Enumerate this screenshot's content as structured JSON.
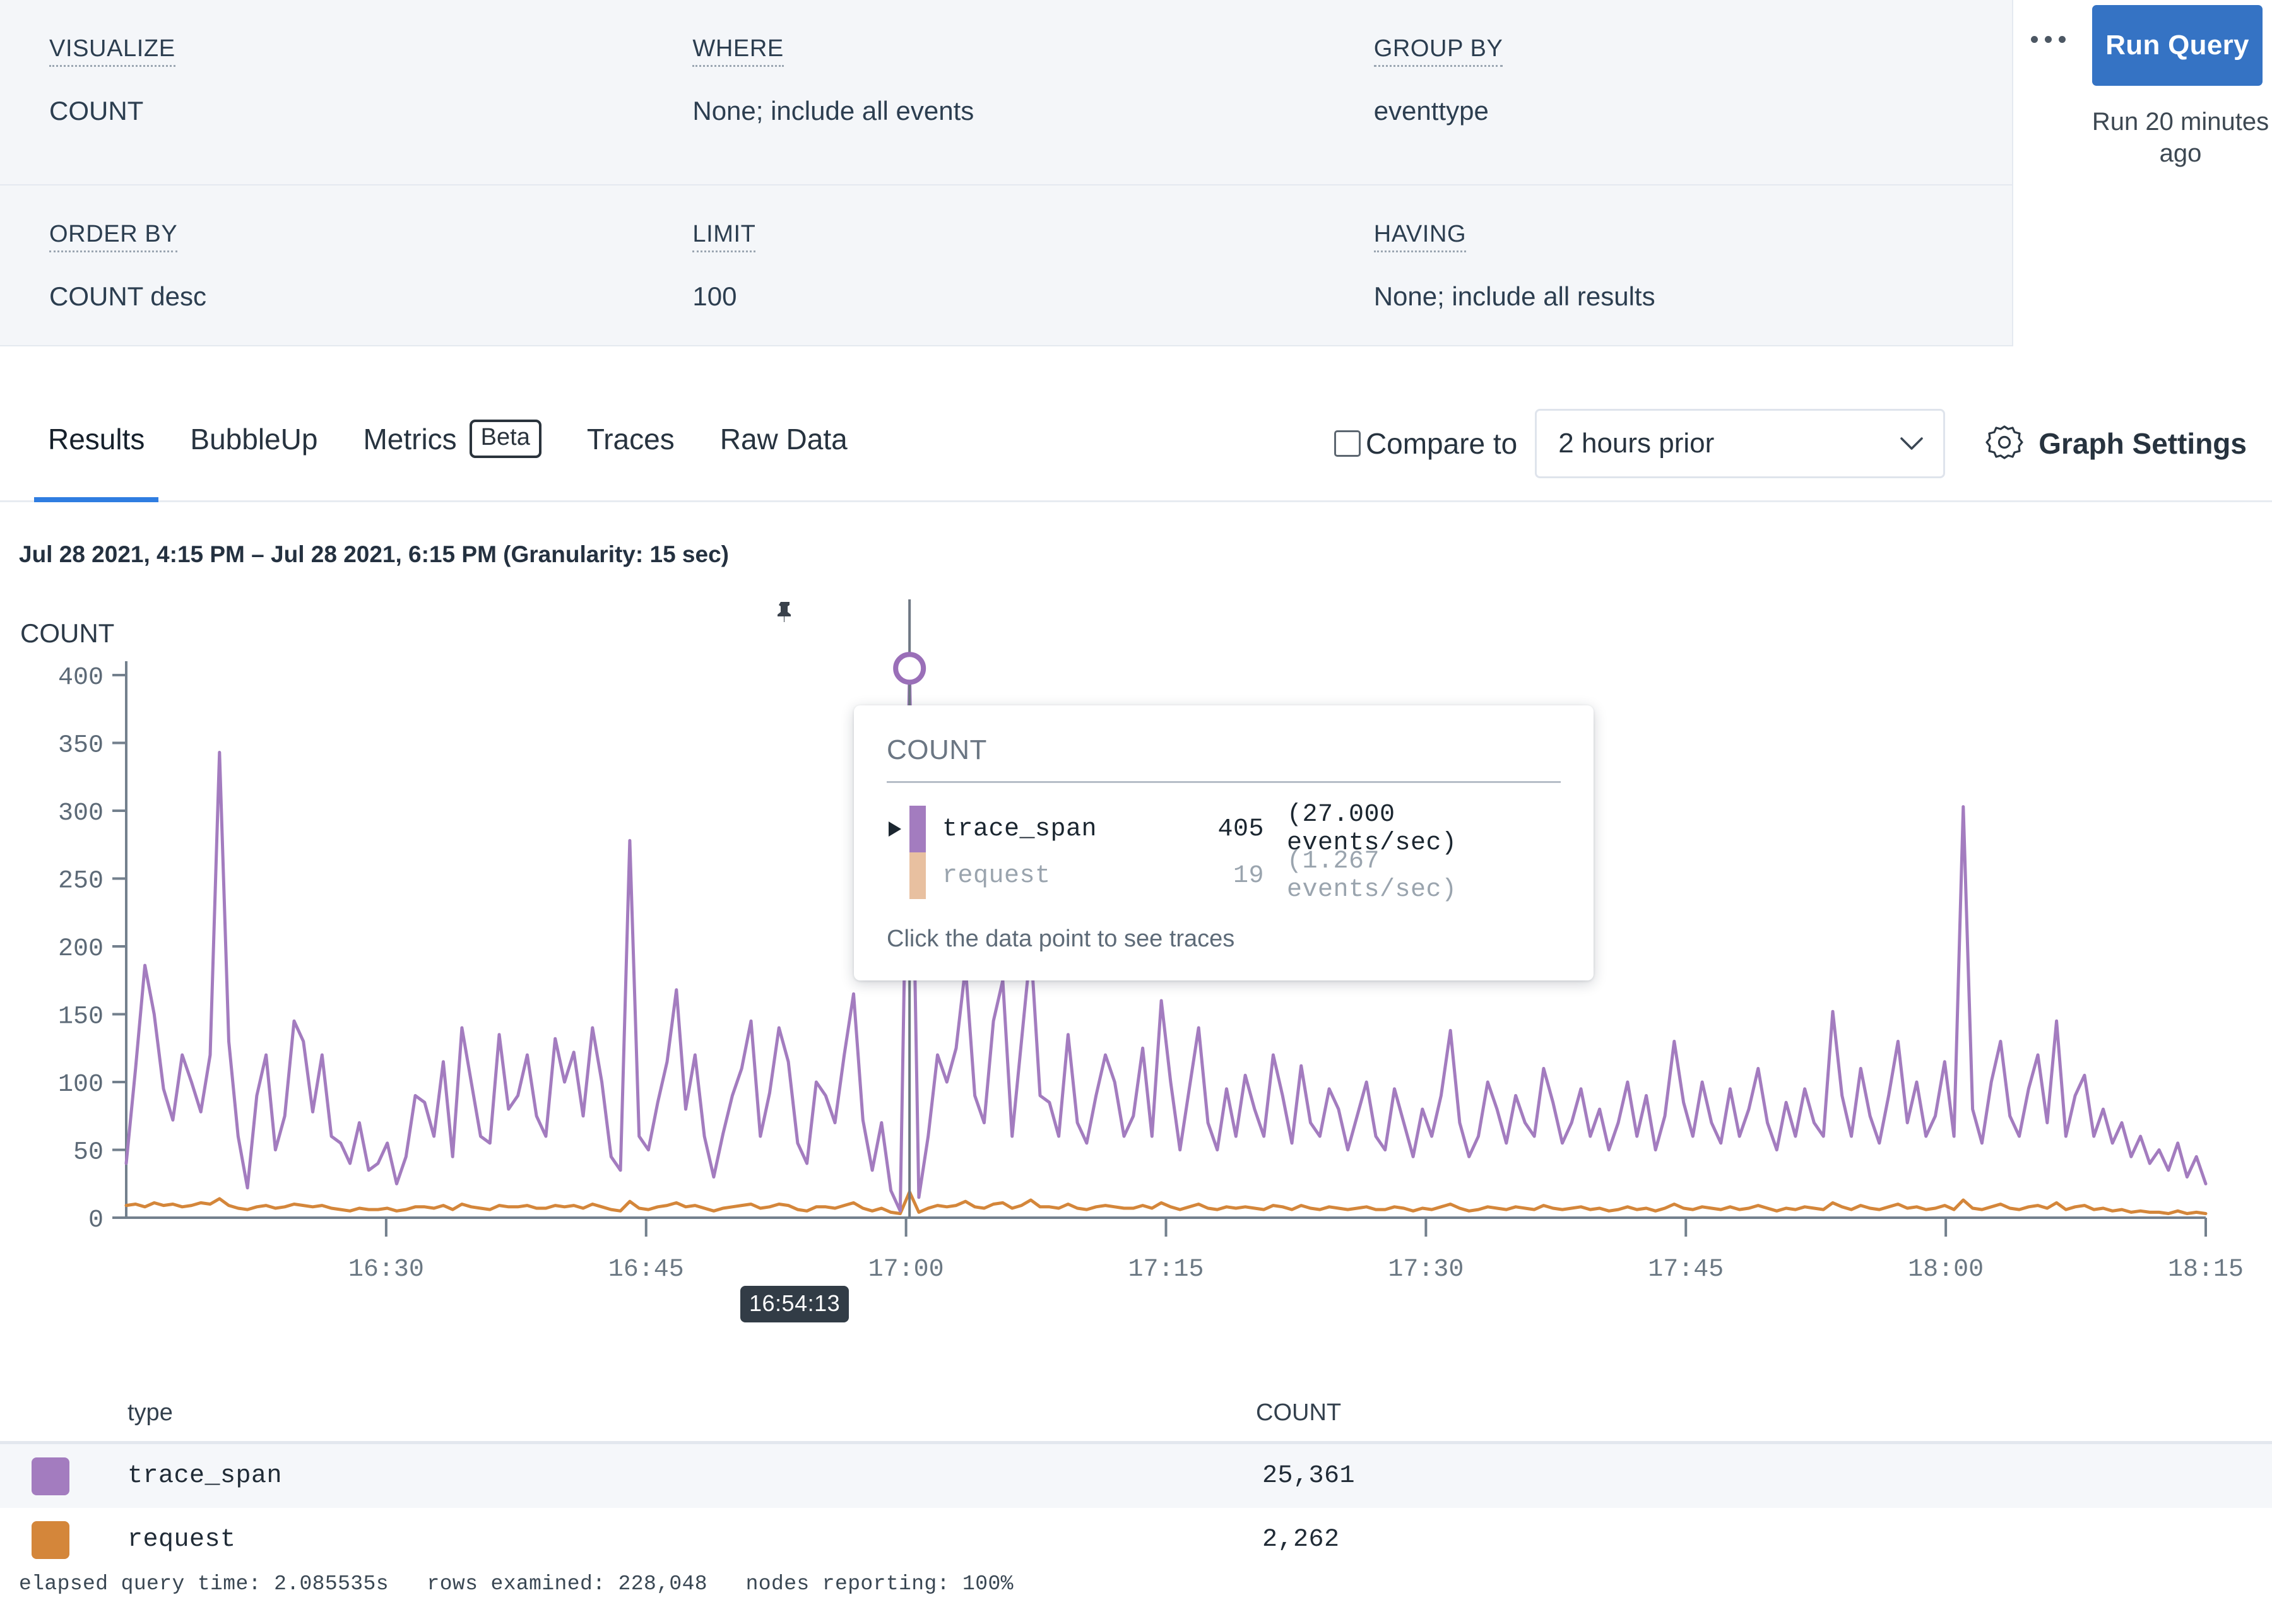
{
  "query_builder": {
    "clauses": [
      {
        "label": "VISUALIZE",
        "value": "COUNT"
      },
      {
        "label": "WHERE",
        "value": "None; include all events"
      },
      {
        "label": "GROUP BY",
        "value": "eventtype"
      },
      {
        "label": "ORDER BY",
        "value": "COUNT desc"
      },
      {
        "label": "LIMIT",
        "value": "100"
      },
      {
        "label": "HAVING",
        "value": "None; include all results"
      }
    ],
    "more_menu": "more-options",
    "run_button": "Run Query",
    "run_status": "Run 20 minutes ago"
  },
  "tabs": [
    {
      "label": "Results",
      "active": true,
      "badge": ""
    },
    {
      "label": "BubbleUp",
      "active": false,
      "badge": ""
    },
    {
      "label": "Metrics",
      "active": false,
      "badge": "Beta"
    },
    {
      "label": "Traces",
      "active": false,
      "badge": ""
    },
    {
      "label": "Raw Data",
      "active": false,
      "badge": ""
    }
  ],
  "graph_controls": {
    "compare_label": "Compare to",
    "compare_checked": false,
    "compare_value": "2 hours prior",
    "graph_settings_label": "Graph Settings"
  },
  "chart_header": {
    "range_text": "Jul 28 2021, 4:15 PM – Jul 28 2021, 6:15 PM (Granularity: 15 sec)",
    "y_axis_label": "COUNT"
  },
  "tooltip": {
    "title": "COUNT",
    "rows": [
      {
        "name": "trace_span",
        "value": "405",
        "rate": "(27.000 events/sec)",
        "color": "#a37cbf",
        "expandable": true
      },
      {
        "name": "request",
        "value": "19",
        "rate": "(1.267 events/sec)",
        "color": "#e8c0a0",
        "expandable": false
      }
    ],
    "hint": "Click the data point to see traces"
  },
  "crosshair": {
    "time_label": "16:54:13",
    "marker_value": 405
  },
  "legend_table": {
    "columns": [
      "type",
      "COUNT"
    ],
    "rows": [
      {
        "type": "trace_span",
        "count": "25,361",
        "color": "#a37cbf"
      },
      {
        "type": "request",
        "count": "2,262",
        "color": "#d4863a"
      }
    ]
  },
  "footer": {
    "stats": "elapsed query time: 2.085535s   rows examined: 228,048   nodes reporting: 100%"
  },
  "colors": {
    "accent": "#3573c4",
    "trace_span": "#a37cbf",
    "request": "#d4863a",
    "panel_bg": "#f4f6f9",
    "tab_underline": "#2f7de1"
  },
  "chart_data": {
    "type": "line",
    "title": "COUNT",
    "xlabel": "",
    "ylabel": "COUNT",
    "ylim": [
      0,
      400
    ],
    "yticks": [
      0,
      50,
      100,
      150,
      200,
      250,
      300,
      350,
      400
    ],
    "xticks": [
      "16:30",
      "16:45",
      "17:00",
      "17:15",
      "17:30",
      "17:45",
      "18:00",
      "18:15"
    ],
    "x_range": [
      "16:15",
      "18:15"
    ],
    "grid": false,
    "legend_position": "below-chart-table",
    "granularity_sec": 15,
    "annotations": [
      {
        "type": "crosshair",
        "x": "16:54:13",
        "y": 405,
        "label": "16:54:13"
      }
    ],
    "series": [
      {
        "name": "trace_span",
        "color": "#a37cbf",
        "total": 25361,
        "values": [
          40,
          110,
          186,
          150,
          95,
          72,
          120,
          100,
          78,
          120,
          343,
          130,
          60,
          22,
          90,
          120,
          50,
          75,
          145,
          130,
          78,
          120,
          60,
          55,
          40,
          70,
          35,
          40,
          55,
          25,
          45,
          90,
          85,
          60,
          115,
          45,
          140,
          100,
          60,
          55,
          135,
          80,
          90,
          120,
          75,
          60,
          132,
          100,
          122,
          75,
          140,
          100,
          45,
          35,
          278,
          60,
          50,
          85,
          115,
          168,
          80,
          120,
          60,
          30,
          62,
          90,
          110,
          145,
          60,
          92,
          140,
          115,
          55,
          40,
          100,
          90,
          70,
          120,
          165,
          72,
          35,
          70,
          20,
          5,
          405,
          15,
          60,
          120,
          100,
          125,
          185,
          90,
          70,
          145,
          175,
          60,
          130,
          200,
          90,
          85,
          60,
          135,
          70,
          55,
          90,
          120,
          100,
          60,
          75,
          125,
          60,
          160,
          100,
          50,
          95,
          140,
          70,
          50,
          95,
          60,
          105,
          80,
          60,
          120,
          90,
          55,
          112,
          70,
          60,
          95,
          80,
          50,
          75,
          100,
          60,
          50,
          95,
          70,
          45,
          80,
          60,
          90,
          138,
          70,
          45,
          60,
          100,
          80,
          55,
          90,
          70,
          60,
          110,
          85,
          55,
          70,
          95,
          60,
          80,
          50,
          70,
          100,
          60,
          90,
          50,
          75,
          130,
          85,
          60,
          100,
          70,
          55,
          95,
          60,
          80,
          110,
          70,
          50,
          85,
          60,
          95,
          70,
          60,
          152,
          90,
          60,
          110,
          75,
          55,
          90,
          130,
          70,
          100,
          60,
          75,
          115,
          60,
          303,
          80,
          55,
          100,
          130,
          75,
          60,
          95,
          120,
          70,
          145,
          60,
          90,
          105,
          60,
          80,
          55,
          70,
          45,
          60,
          40,
          50,
          35,
          55,
          30,
          45,
          25
        ]
      },
      {
        "name": "request",
        "color": "#d4863a",
        "total": 2262,
        "values": [
          9,
          10,
          8,
          11,
          9,
          10,
          8,
          9,
          11,
          10,
          14,
          9,
          7,
          6,
          8,
          9,
          7,
          8,
          10,
          9,
          8,
          9,
          7,
          6,
          5,
          7,
          6,
          6,
          7,
          5,
          6,
          8,
          8,
          7,
          9,
          6,
          10,
          8,
          7,
          6,
          9,
          8,
          8,
          9,
          7,
          7,
          9,
          8,
          9,
          7,
          10,
          8,
          6,
          5,
          12,
          7,
          6,
          8,
          9,
          11,
          8,
          9,
          7,
          5,
          7,
          8,
          9,
          10,
          7,
          8,
          10,
          9,
          6,
          5,
          8,
          8,
          7,
          9,
          11,
          7,
          5,
          7,
          4,
          3,
          19,
          4,
          7,
          9,
          8,
          9,
          12,
          8,
          7,
          10,
          11,
          7,
          9,
          13,
          8,
          8,
          7,
          10,
          7,
          6,
          8,
          9,
          8,
          7,
          7,
          9,
          7,
          11,
          8,
          6,
          8,
          10,
          7,
          6,
          8,
          7,
          8,
          7,
          6,
          9,
          8,
          6,
          9,
          7,
          6,
          8,
          7,
          6,
          7,
          8,
          6,
          6,
          8,
          7,
          5,
          7,
          6,
          8,
          10,
          7,
          5,
          6,
          8,
          7,
          6,
          8,
          7,
          6,
          9,
          7,
          6,
          7,
          8,
          6,
          7,
          5,
          6,
          8,
          6,
          7,
          5,
          7,
          10,
          7,
          6,
          8,
          7,
          6,
          8,
          6,
          7,
          9,
          7,
          5,
          7,
          6,
          8,
          7,
          6,
          11,
          8,
          6,
          9,
          7,
          6,
          8,
          10,
          7,
          8,
          6,
          7,
          9,
          6,
          13,
          7,
          6,
          8,
          10,
          7,
          6,
          8,
          9,
          7,
          11,
          6,
          8,
          9,
          6,
          7,
          5,
          6,
          4,
          5,
          4,
          4,
          3,
          5,
          3,
          4,
          3
        ]
      }
    ]
  }
}
